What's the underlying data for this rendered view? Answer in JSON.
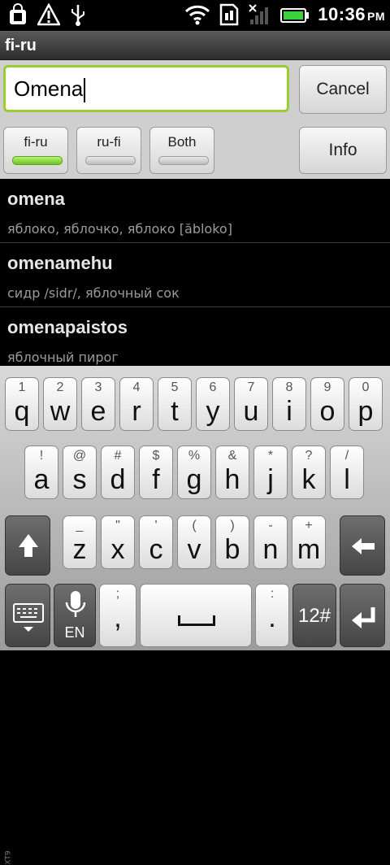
{
  "status": {
    "time": "10:36",
    "ampm": "PM"
  },
  "title": "fi-ru",
  "search": {
    "value": "Omena",
    "cancel_label": "Cancel"
  },
  "directions": [
    {
      "label": "fi-ru",
      "active": true
    },
    {
      "label": "ru-fi",
      "active": false
    },
    {
      "label": "Both",
      "active": false
    }
  ],
  "info_label": "Info",
  "results": [
    {
      "word": "omena",
      "translation": "яблоко, яблочко, яблоко [ăbloko]"
    },
    {
      "word": "omenamehu",
      "translation": "сидр /sidr/, яблочный сок"
    },
    {
      "word": "omenapaistos",
      "translation": "яблочный пирог"
    }
  ],
  "keyboard": {
    "row1": [
      {
        "s": "1",
        "p": "q"
      },
      {
        "s": "2",
        "p": "w"
      },
      {
        "s": "3",
        "p": "e"
      },
      {
        "s": "4",
        "p": "r"
      },
      {
        "s": "5",
        "p": "t"
      },
      {
        "s": "6",
        "p": "y"
      },
      {
        "s": "7",
        "p": "u"
      },
      {
        "s": "8",
        "p": "i"
      },
      {
        "s": "9",
        "p": "o"
      },
      {
        "s": "0",
        "p": "p"
      }
    ],
    "row2": [
      {
        "s": "!",
        "p": "a"
      },
      {
        "s": "@",
        "p": "s"
      },
      {
        "s": "#",
        "p": "d"
      },
      {
        "s": "$",
        "p": "f"
      },
      {
        "s": "%",
        "p": "g"
      },
      {
        "s": "&",
        "p": "h"
      },
      {
        "s": "*",
        "p": "j"
      },
      {
        "s": "?",
        "p": "k"
      },
      {
        "s": "/",
        "p": "l"
      }
    ],
    "row3": [
      {
        "s": "_",
        "p": "z"
      },
      {
        "s": "\"",
        "p": "x"
      },
      {
        "s": "'",
        "p": "c"
      },
      {
        "s": "(",
        "p": "v"
      },
      {
        "s": ")",
        "p": "b"
      },
      {
        "s": "-",
        "p": "n"
      },
      {
        "s": "+",
        "p": "m"
      }
    ],
    "mic_label": "EN",
    "semicolon_sec": ";",
    "comma": ",",
    "colon_sec": ":",
    "period": ".",
    "numsym_label": "12#",
    "xt9": "XT9"
  }
}
